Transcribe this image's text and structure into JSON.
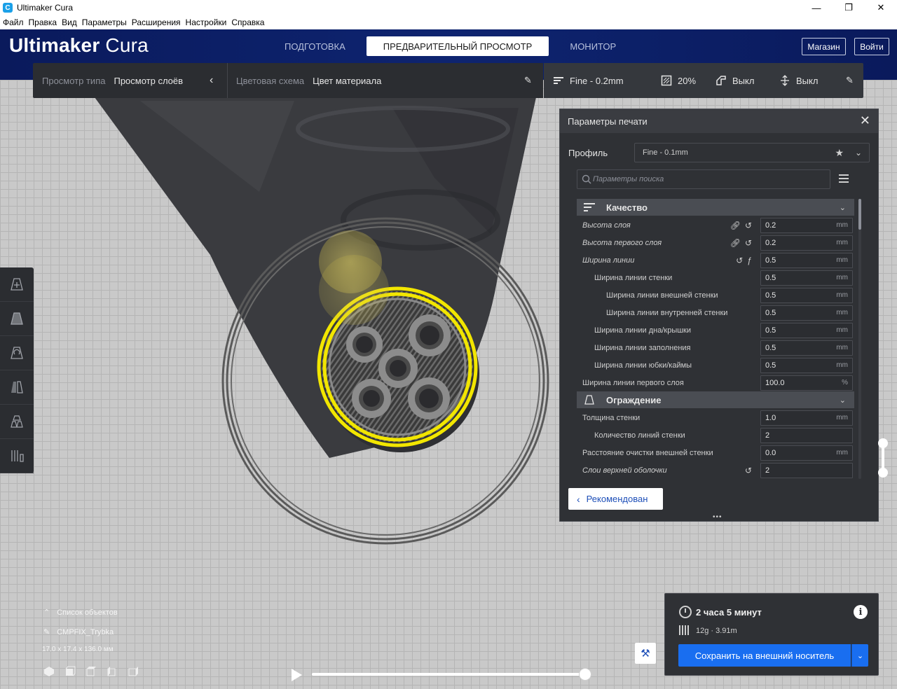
{
  "window": {
    "title": "Ultimaker Cura",
    "controls": [
      "—",
      "❐",
      "✕"
    ]
  },
  "menu": [
    "Файл",
    "Правка",
    "Вид",
    "Параметры",
    "Расширения",
    "Настройки",
    "Справка"
  ],
  "header": {
    "logo_bold": "Ultimaker",
    "logo_light": " Cura",
    "tabs": [
      "ПОДГОТОВКА",
      "ПРЕДВАРИТЕЛЬНЫЙ ПРОСМОТР",
      "МОНИТОР"
    ],
    "active_tab": "ПРЕДВАРИТЕЛЬНЫЙ ПРОСМОТР",
    "marketplace": "Магазин",
    "signin": "Войти"
  },
  "viewbar": {
    "view_type_label": "Просмотр типа",
    "view_type_value": "Просмотр слоёв",
    "color_scheme_label": "Цветовая схема",
    "color_scheme_value": "Цвет материала"
  },
  "settingsbar": {
    "profile": "Fine - 0.2mm",
    "infill": "20%",
    "support": "Выкл",
    "adhesion": "Выкл"
  },
  "panel": {
    "title": "Параметры печати",
    "profile_label": "Профиль",
    "profile_value": "Fine - 0.1mm",
    "search_placeholder": "Параметры поиска",
    "categories": [
      {
        "name": "Качество",
        "settings": [
          {
            "name": "Высота слоя",
            "italic": true,
            "indent": 0,
            "value": "0.2",
            "unit": "mm",
            "link": true,
            "reset": true,
            "func": false
          },
          {
            "name": "Высота первого слоя",
            "italic": true,
            "indent": 0,
            "value": "0.2",
            "unit": "mm",
            "link": true,
            "reset": true,
            "func": false
          },
          {
            "name": "Ширина линии",
            "italic": true,
            "indent": 0,
            "value": "0.5",
            "unit": "mm",
            "link": false,
            "reset": true,
            "func": true
          },
          {
            "name": "Ширина линии стенки",
            "italic": false,
            "indent": 1,
            "value": "0.5",
            "unit": "mm"
          },
          {
            "name": "Ширина линии внешней стенки",
            "italic": false,
            "indent": 2,
            "value": "0.5",
            "unit": "mm"
          },
          {
            "name": "Ширина линии внутренней стенки",
            "italic": false,
            "indent": 2,
            "value": "0.5",
            "unit": "mm"
          },
          {
            "name": "Ширина линии дна/крышки",
            "italic": false,
            "indent": 1,
            "value": "0.5",
            "unit": "mm"
          },
          {
            "name": "Ширина линии заполнения",
            "italic": false,
            "indent": 1,
            "value": "0.5",
            "unit": "mm"
          },
          {
            "name": "Ширина линии юбки/каймы",
            "italic": false,
            "indent": 1,
            "value": "0.5",
            "unit": "mm"
          },
          {
            "name": "Ширина линии первого слоя",
            "italic": false,
            "indent": 0,
            "value": "100.0",
            "unit": "%"
          }
        ]
      },
      {
        "name": "Ограждение",
        "settings": [
          {
            "name": "Толщина стенки",
            "italic": false,
            "indent": 0,
            "value": "1.0",
            "unit": "mm"
          },
          {
            "name": "Количество линий стенки",
            "italic": false,
            "indent": 1,
            "value": "2",
            "unit": ""
          },
          {
            "name": "Расстояние очистки внешней стенки",
            "italic": false,
            "indent": 0,
            "value": "0.0",
            "unit": "mm"
          },
          {
            "name": "Слои верхней оболочки",
            "italic": true,
            "indent": 0,
            "value": "2",
            "unit": "",
            "reset": true
          }
        ]
      }
    ],
    "recommended_button": "Рекомендован"
  },
  "objects": {
    "list_label": "Список объектов",
    "object_name": "CMPFIX_Trybka",
    "dimensions": "17.0 x 17.4 x 136.0 мм"
  },
  "output": {
    "print_time": "2 часа 5 минут",
    "material": "12g · 3.91m",
    "save_button": "Сохранить на внешний носитель"
  },
  "colors": {
    "header_bg": "#0e2470",
    "accent_blue": "#196ef0",
    "panel_bg": "#2f3135",
    "layer_yellow": "#f2e600"
  }
}
